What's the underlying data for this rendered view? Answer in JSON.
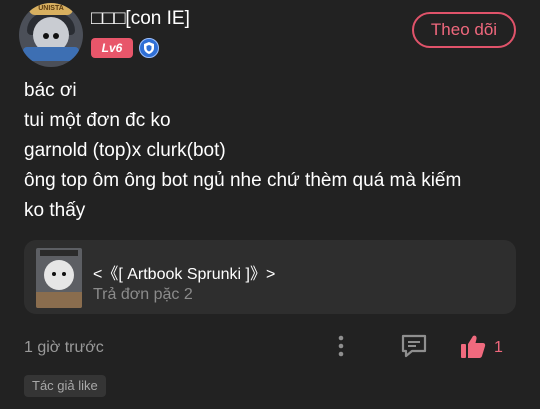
{
  "post": {
    "username": "□□□[con IE]",
    "level_badge": "Lv6",
    "follow_label": "Theo dõi",
    "avatar_banner_text": "UNISTA",
    "body_lines": [
      "bác ơi",
      "tui một đơn đc ko",
      "garnold (top)x clurk(bot)",
      "ông top ôm ông bot ngủ nhe chứ thèm quá mà kiếm",
      "ko thấy"
    ]
  },
  "linked_card": {
    "title": "<《[ Artbook Sprunki ]》>",
    "subtitle": "Trả đơn pặc 2"
  },
  "footer": {
    "time": "1 giờ trước",
    "like_count": "1",
    "author_tag": "Tác giả like"
  },
  "colors": {
    "background": "#222222",
    "accent": "#e0536a",
    "card_background": "#2e2e2e"
  },
  "icons": {
    "more": "more-vertical-icon",
    "comment": "comment-icon",
    "like": "thumbs-up-icon",
    "level_shield": "shield-icon"
  }
}
